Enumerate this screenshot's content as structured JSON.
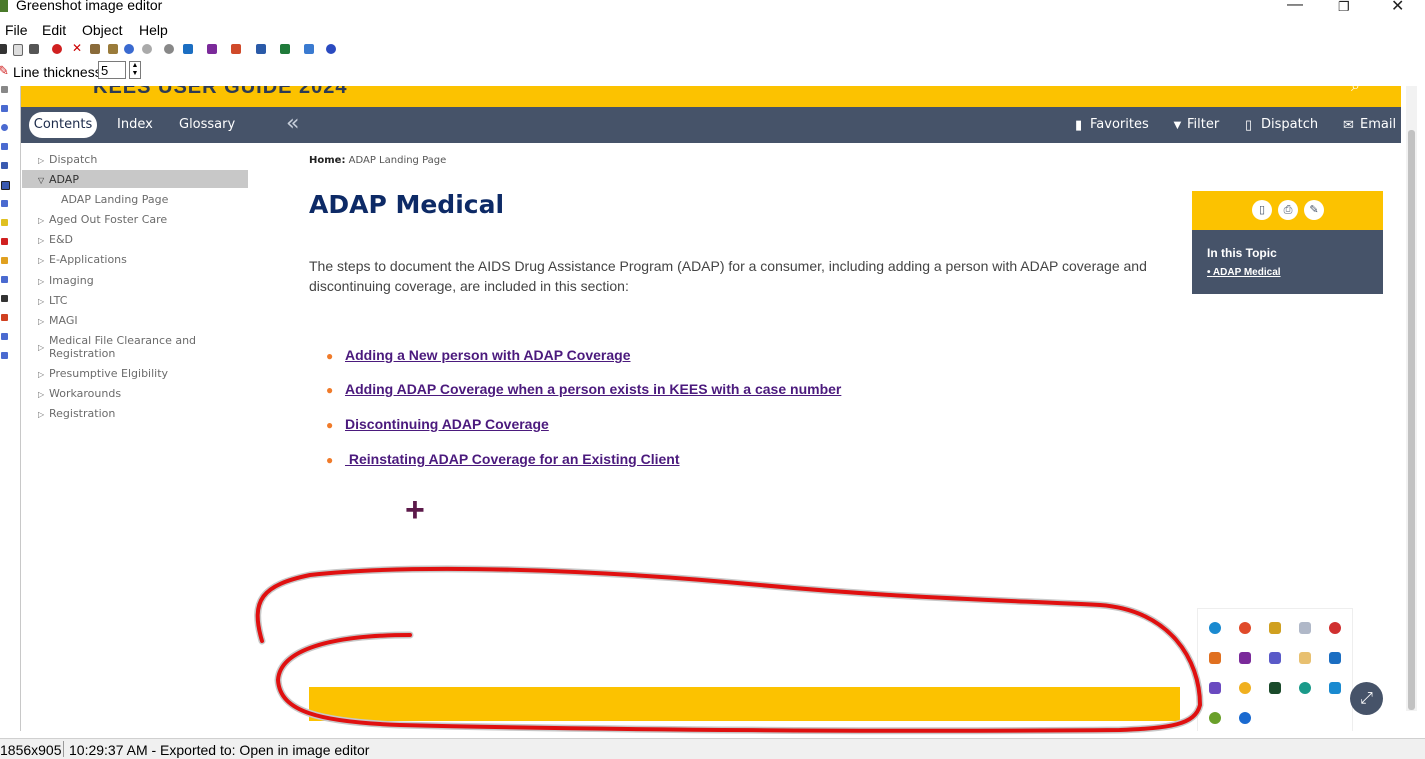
{
  "window": {
    "title": "Greenshot image editor",
    "controls": [
      "—",
      "❐",
      "✕"
    ]
  },
  "menu": [
    "File",
    "Edit",
    "Object",
    "Help"
  ],
  "line_thickness": {
    "label": "Line thickness",
    "value": "5"
  },
  "site": {
    "header_title": "KEES USER GUIDE 2024",
    "nav": {
      "tabs": [
        "Contents",
        "Index",
        "Glossary"
      ],
      "collapse_glyph": "«",
      "actions": [
        {
          "label": "Favorites",
          "icon": "bookmark-icon"
        },
        {
          "label": "Filter",
          "icon": "filter-icon"
        },
        {
          "label": "Dispatch",
          "icon": "clipboard-icon"
        },
        {
          "label": "Email",
          "icon": "envelope-icon"
        }
      ]
    },
    "toc": [
      {
        "label": "Dispatch",
        "state": "collapsed"
      },
      {
        "label": "ADAP",
        "state": "expanded"
      },
      {
        "label": "ADAP Landing Page",
        "state": "child"
      },
      {
        "label": "Aged Out Foster Care",
        "state": "collapsed"
      },
      {
        "label": "E&D",
        "state": "collapsed"
      },
      {
        "label": "E-Applications",
        "state": "collapsed"
      },
      {
        "label": "Imaging",
        "state": "collapsed"
      },
      {
        "label": "LTC",
        "state": "collapsed"
      },
      {
        "label": "MAGI",
        "state": "collapsed"
      },
      {
        "label": "Medical File Clearance and",
        "label2": "Registration",
        "state": "collapsed"
      },
      {
        "label": "Presumptive Elgibility",
        "state": "collapsed"
      },
      {
        "label": "Workarounds",
        "state": "collapsed"
      },
      {
        "label": "Registration",
        "state": "collapsed"
      }
    ],
    "breadcrumb": {
      "home": "Home:",
      "current": "ADAP Landing Page"
    },
    "page_title": "ADAP Medical",
    "intro": "The steps to document the AIDS Drug Assistance Program (ADAP)  for a consumer, including adding a person with ADAP coverage and discontinuing coverage, are included in this section:",
    "links": [
      "Adding a New person with ADAP Coverage",
      "Adding ADAP Coverage when a person exists in KEES with a case number",
      "Discontinuing ADAP Coverage",
      " Reinstating ADAP Coverage for an Existing Client"
    ],
    "topic": {
      "heading": "In this Topic",
      "link": "ADAP Medical"
    }
  },
  "status": {
    "size": "1856x905",
    "message": "10:29:37 AM - Exported to: Open in image editor"
  },
  "colors": {
    "accent_yellow": "#fcc200",
    "nav_slate": "#465369",
    "link_purple": "#4b1a7d",
    "annotation_red": "#e01010"
  }
}
